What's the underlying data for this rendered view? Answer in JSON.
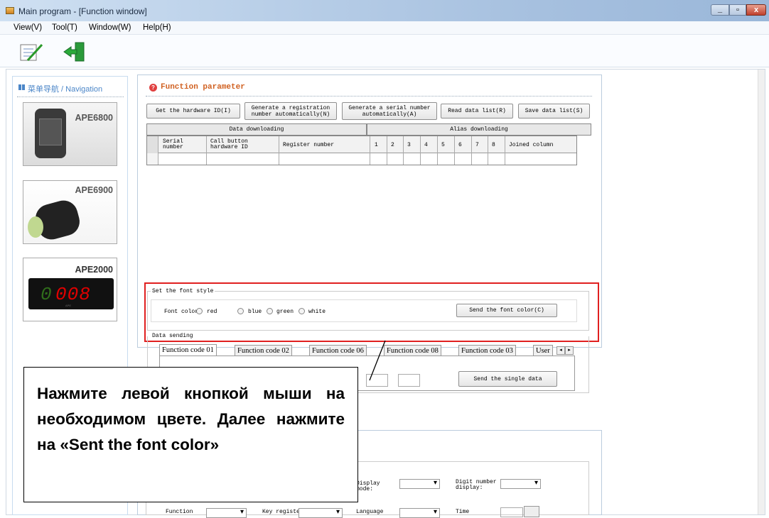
{
  "window": {
    "title": "Main program - [Function window]"
  },
  "menu": [
    "View(V)",
    "Tool(T)",
    "Window(W)",
    "Help(H)"
  ],
  "nav": {
    "title": "菜单导航 / Navigation",
    "cards": [
      "APE6800",
      "APE6900",
      "APE2000"
    ],
    "display_number": "008",
    "display_brand": "APE"
  },
  "panel": {
    "title": "Function parameter",
    "buttons": [
      "Get the hardware ID(I)",
      "Generate a registration number automatically(N)",
      "Generate a serial number automatically(A)",
      "Read data list(R)",
      "Save data list(S)"
    ],
    "table": {
      "groups": [
        "Data downloading",
        "Alias downloading"
      ],
      "headers": [
        "Serial number",
        "Call button hardware ID",
        "Register number",
        "1",
        "2",
        "3",
        "4",
        "5",
        "6",
        "7",
        "8",
        "Joined column"
      ]
    }
  },
  "font_style": {
    "legend": "Set the font style",
    "label": "Font color:",
    "options": [
      "red",
      "blue",
      "green",
      "white"
    ],
    "send_button": "Send the font color(C)"
  },
  "data_sending": {
    "legend": "Data sending",
    "tabs": [
      "Function code 01",
      "Function code 02",
      "Function code 06",
      "Function code 08",
      "Function code 03",
      "User"
    ],
    "send_button": "Send the single data"
  },
  "lower": {
    "fields": [
      "Display mode:",
      "Digit number display:",
      "Function",
      "Key register",
      "Language",
      "Time"
    ]
  },
  "callout": {
    "text": "Нажмите левой кнопкой мыши на необходимом цвете. Далее нажмите на «Sent the font color»"
  },
  "colors": {
    "highlight": "#e02020",
    "titlebar": "#b9cfe8",
    "accent_led": "#e00000"
  }
}
